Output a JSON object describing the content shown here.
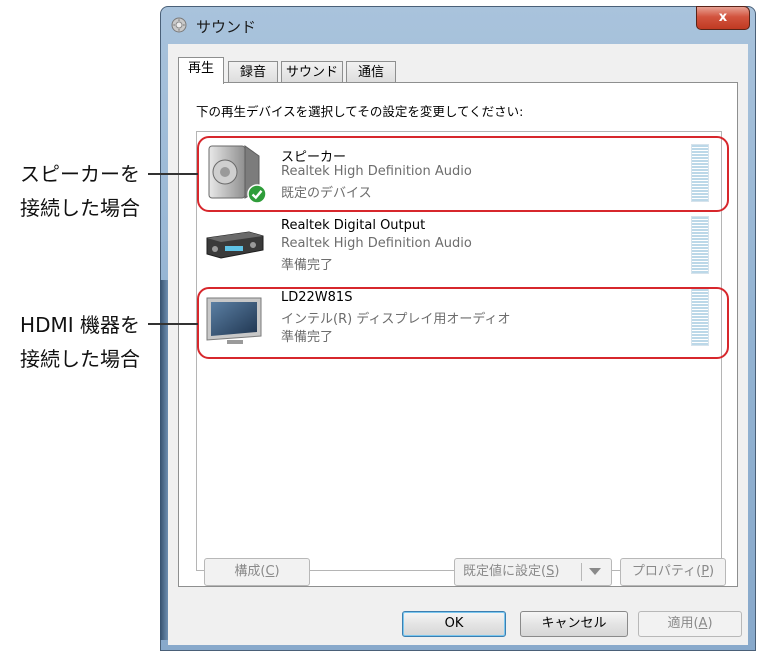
{
  "window": {
    "title": "サウンド",
    "close_label": "x"
  },
  "tabs": [
    {
      "label": "再生",
      "active": true
    },
    {
      "label": "録音",
      "active": false
    },
    {
      "label": "サウンド",
      "active": false
    },
    {
      "label": "通信",
      "active": false
    }
  ],
  "instruction": "下の再生デバイスを選択してその設定を変更してください:",
  "devices": [
    {
      "name": "スピーカー",
      "driver": "Realtek High Definition Audio",
      "status": "既定のデバイス",
      "icon": "speaker-icon",
      "is_default": true
    },
    {
      "name": "Realtek Digital Output",
      "driver": "Realtek High Definition Audio",
      "status": "準備完了",
      "icon": "receiver-icon",
      "is_default": false
    },
    {
      "name": "LD22W81S",
      "driver": "インテル(R) ディスプレイ用オーディオ",
      "status": "準備完了",
      "icon": "monitor-icon",
      "is_default": false
    }
  ],
  "buttons": {
    "configure": {
      "label": "構成(",
      "accel": "C",
      "tail": ")"
    },
    "set_default": {
      "label": "既定値に設定(",
      "accel": "S",
      "tail": ")"
    },
    "properties": {
      "label": "プロパティ(",
      "accel": "P",
      "tail": ")"
    },
    "ok": "OK",
    "cancel": "キャンセル",
    "apply": {
      "label": "適用(",
      "accel": "A",
      "tail": ")"
    }
  },
  "annotations": [
    {
      "line1": "スピーカーを",
      "line2": "接続した場合"
    },
    {
      "line1": "HDMI 機器を",
      "line2": "接続した場合"
    }
  ],
  "colors": {
    "callout": "#d7272c",
    "titlebar": "#a9c3dc",
    "close_button": "#c03a22"
  }
}
